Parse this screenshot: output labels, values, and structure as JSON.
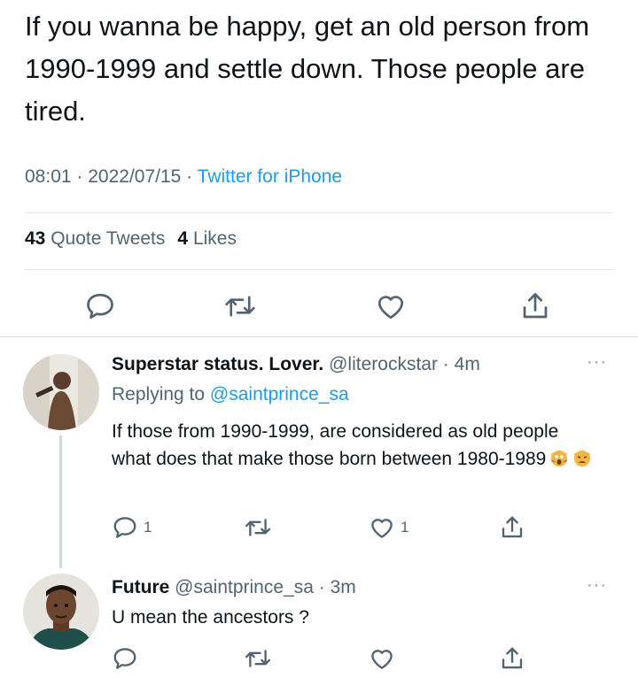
{
  "tweet": {
    "text": "If you wanna be happy, get an old person from 1990-1999 and settle down. Those people are tired.",
    "time": "08:01",
    "date": "2022/07/15",
    "source": "Twitter for iPhone",
    "quote_tweets_count": "43",
    "quote_tweets_label": "Quote Tweets",
    "likes_count": "4",
    "likes_label": "Likes"
  },
  "replies": [
    {
      "name": "Superstar status. Lover.",
      "handle": "@literockstar",
      "time": "4m",
      "replying_to_label": "Replying to",
      "replying_to": "@saintprince_sa",
      "text": "If those from 1990-1999, are considered as old people what does that make those born between 1980-1989",
      "emojis": [
        "scream-cat-emoji",
        "weary-cat-emoji"
      ],
      "reply_count": "1",
      "retweet_count": "",
      "like_count": "1"
    },
    {
      "name": "Future",
      "handle": "@saintprince_sa",
      "time": "3m",
      "text": "U mean the ancestors ?",
      "reply_count": "",
      "retweet_count": "",
      "like_count": ""
    }
  ],
  "more_label": "···",
  "separator": "·",
  "icons": {
    "reply": "reply-icon",
    "retweet": "retweet-icon",
    "like": "heart-icon",
    "share": "share-icon",
    "more": "more-icon"
  },
  "colors": {
    "text": "#0f1419",
    "secondary": "#536471",
    "link": "#1d9bf0",
    "border": "#e3e6e8"
  }
}
